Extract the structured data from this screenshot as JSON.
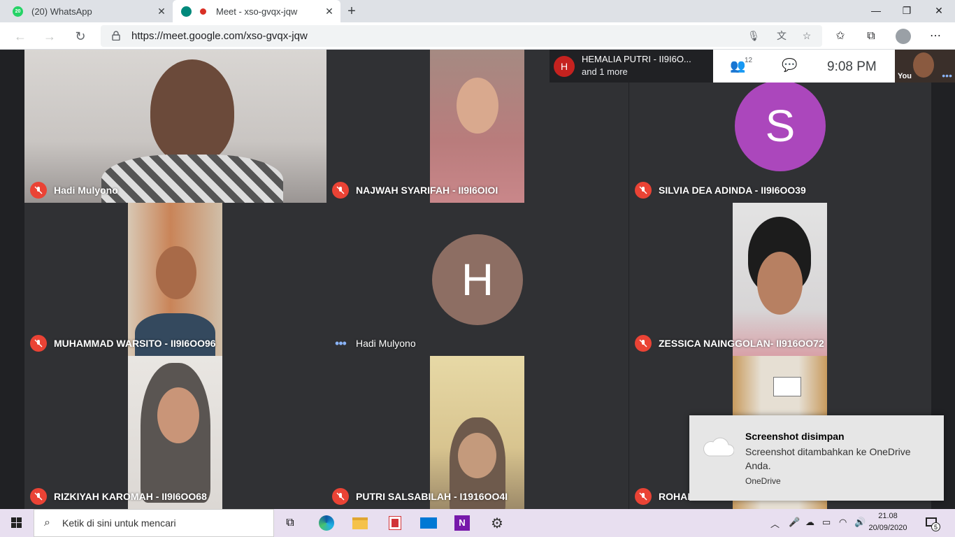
{
  "browser": {
    "tabs": [
      {
        "title": "(20) WhatsApp",
        "badge": "20"
      },
      {
        "title": "Meet - xso-gvqx-jqw"
      }
    ],
    "url": "https://meet.google.com/xso-gvqx-jqw"
  },
  "meet": {
    "presenter": {
      "initial": "H",
      "name": "HEMALIA PUTRI - II9I6O...",
      "more": "and 1 more"
    },
    "people_count": "12",
    "time": "9:08  PM",
    "self_label": "You",
    "tiles": [
      {
        "name": "Hadi Mulyono",
        "state": "muted"
      },
      {
        "name": "NAJWAH SYARIFAH - II9I6OIOI",
        "state": "muted"
      },
      {
        "name": "SILVIA DEA ADINDA - II9I6OO39",
        "state": "muted",
        "avatar": "S",
        "avatar_color": "#ab47bc"
      },
      {
        "name": "MUHAMMAD WARSITO - II9I6OO96",
        "state": "muted"
      },
      {
        "name": "Hadi Mulyono",
        "state": "speaking",
        "avatar": "H",
        "avatar_color": "#8d6e63"
      },
      {
        "name": "ZESSICA NAINGGOLAN- II916OO72",
        "state": "muted"
      },
      {
        "name": "RIZKIYAH KAROMAH - II9I6OO68",
        "state": "muted"
      },
      {
        "name": "PUTRI SALSABILAH - I1916OO4I",
        "state": "muted"
      },
      {
        "name": "ROHAN",
        "state": "muted"
      }
    ]
  },
  "notification": {
    "title": "Screenshot disimpan",
    "body": "Screenshot ditambahkan ke OneDrive Anda.",
    "source": "OneDrive"
  },
  "taskbar": {
    "search_placeholder": "Ketik di sini untuk mencari",
    "time": "21.08",
    "date": "20/09/2020",
    "notification_count": "5"
  }
}
